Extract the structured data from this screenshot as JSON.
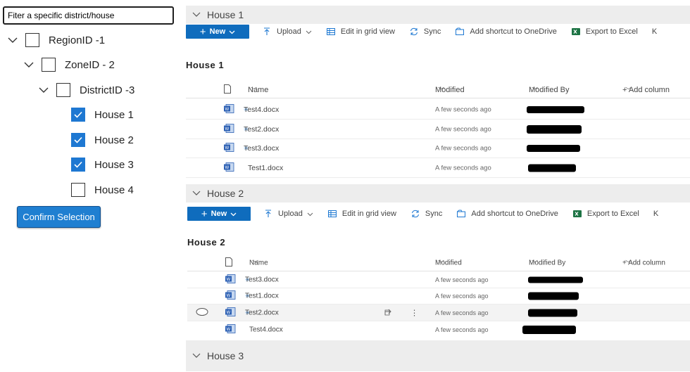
{
  "tree": {
    "filter_value": "Fiter a specific district/house",
    "nodes": [
      {
        "label": "RegionID -1",
        "checked": false
      },
      {
        "label": "ZoneID - 2",
        "checked": false
      },
      {
        "label": "DistrictID -3",
        "checked": false
      },
      {
        "label": "House 1",
        "checked": true
      },
      {
        "label": "House 2",
        "checked": true
      },
      {
        "label": "House 3",
        "checked": true
      },
      {
        "label": "House 4",
        "checked": false
      }
    ],
    "confirm_label": "Confirm Selection"
  },
  "commands": {
    "new": "New",
    "upload": "Upload",
    "grid": "Edit in grid view",
    "sync": "Sync",
    "shortcut": "Add shortcut to OneDrive",
    "export": "Export to Excel",
    "overflow": "K"
  },
  "columns": {
    "name": "Name",
    "modified": "Modified",
    "modified_by": "Modified By",
    "add_column": "+ Add column"
  },
  "sections": [
    {
      "header": "House 1",
      "library_title": "House 1",
      "rows": [
        {
          "name": "Test4.docx",
          "modified": "A few seconds ago"
        },
        {
          "name": "Test2.docx",
          "modified": "A few seconds ago"
        },
        {
          "name": "Test3.docx",
          "modified": "A few seconds ago"
        },
        {
          "name": "Test1.docx",
          "modified": "A few seconds ago"
        }
      ]
    },
    {
      "header": "House 2",
      "library_title": "House 2",
      "rows": [
        {
          "name": "Test3.docx",
          "modified": "A few seconds ago"
        },
        {
          "name": "Test1.docx",
          "modified": "A few seconds ago"
        },
        {
          "name": "Test2.docx",
          "modified": "A few seconds ago"
        },
        {
          "name": "Test4.docx",
          "modified": "A few seconds ago"
        }
      ]
    },
    {
      "header": "House 3"
    }
  ],
  "colors": {
    "accent": "#0f6cbd",
    "checkbox": "#1e78d2",
    "header_bg": "#ededed"
  }
}
